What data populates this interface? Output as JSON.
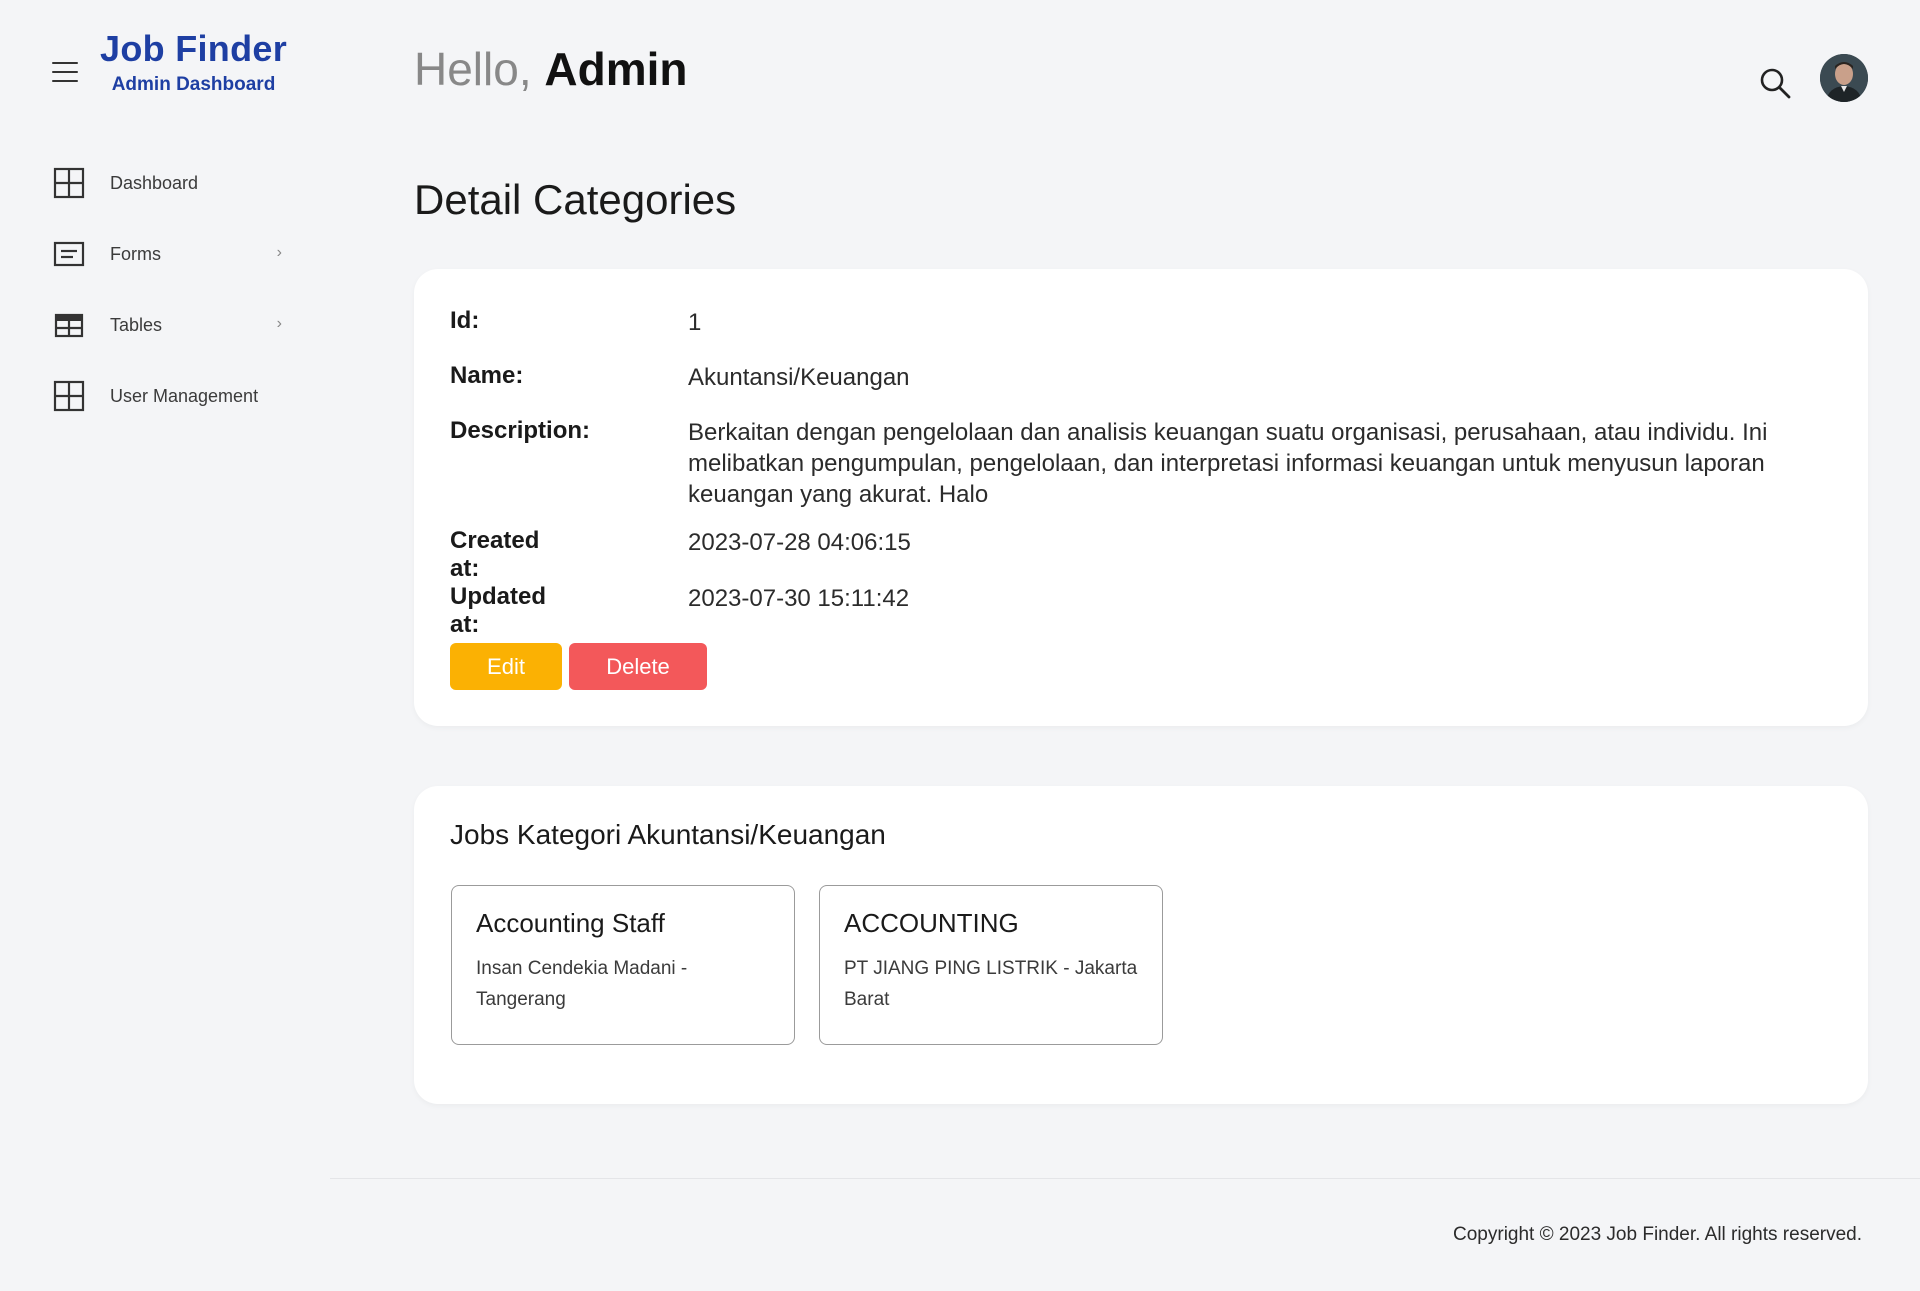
{
  "brand": {
    "title": "Job Finder",
    "subtitle": "Admin Dashboard"
  },
  "sidebar": {
    "items": [
      {
        "label": "Dashboard",
        "icon": "grid-icon",
        "has_submenu": false
      },
      {
        "label": "Forms",
        "icon": "form-icon",
        "has_submenu": true
      },
      {
        "label": "Tables",
        "icon": "table-icon",
        "has_submenu": true
      },
      {
        "label": "User Management",
        "icon": "grid-icon",
        "has_submenu": false
      }
    ],
    "chevron": "›"
  },
  "header": {
    "greeting": "Hello,",
    "user": "Admin"
  },
  "page": {
    "title": "Detail Categories"
  },
  "detail": {
    "id_label": "Id:",
    "id_value": "1",
    "name_label": "Name:",
    "name_value": "Akuntansi/Keuangan",
    "description_label": "Description:",
    "description_value": "Berkaitan dengan pengelolaan dan analisis keuangan suatu organisasi, perusahaan, atau individu. Ini melibatkan pengumpulan, pengelolaan, dan interpretasi informasi keuangan untuk menyusun laporan keuangan yang akurat. Halo",
    "created_label": "Created at:",
    "created_value": "2023-07-28 04:06:15",
    "updated_label": "Updated at:",
    "updated_value": "2023-07-30 15:11:42",
    "edit_label": "Edit",
    "delete_label": "Delete"
  },
  "jobs": {
    "title": "Jobs Kategori Akuntansi/Keuangan",
    "items": [
      {
        "title": "Accounting Staff",
        "company": "Insan Cendekia Madani - Tangerang"
      },
      {
        "title": "ACCOUNTING",
        "company": "PT JIANG PING LISTRIK - Jakarta Barat"
      }
    ]
  },
  "footer": {
    "copyright": "Copyright © 2023 Job Finder. All rights reserved."
  },
  "colors": {
    "brand": "#1e3fa3",
    "edit": "#fbb103",
    "delete": "#f3585a",
    "background": "#f4f5f7"
  }
}
